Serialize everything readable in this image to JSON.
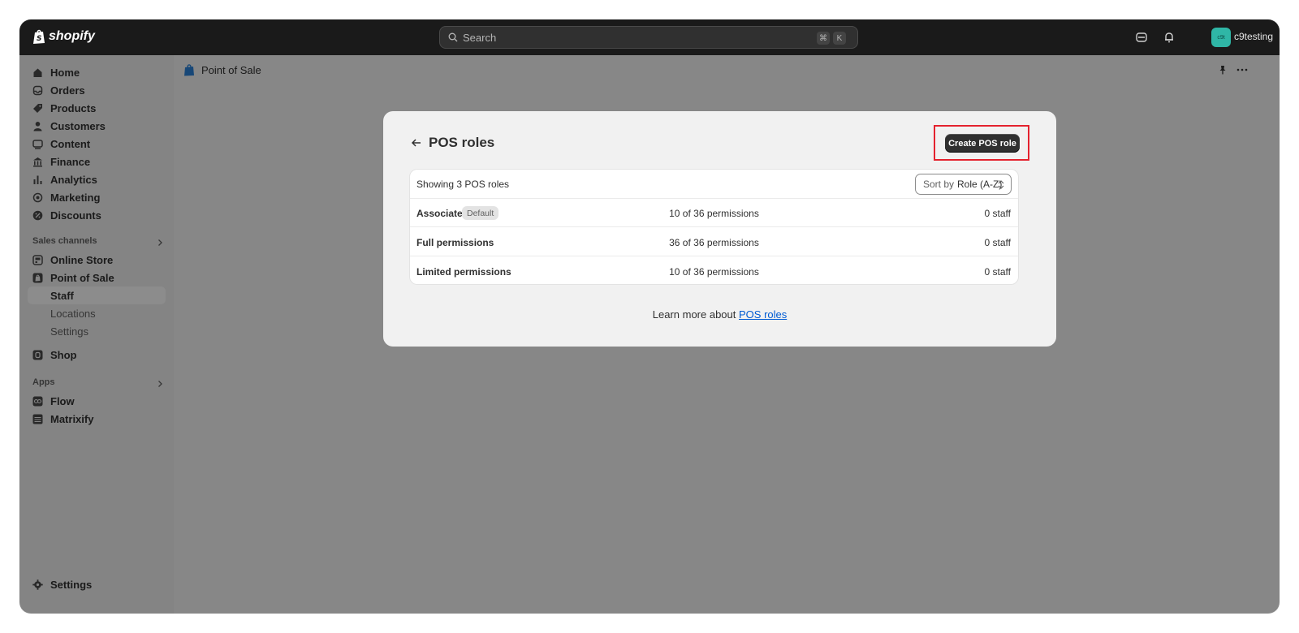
{
  "topbar": {
    "brand": "shopify",
    "search_placeholder": "Search",
    "shortcut_keys": [
      "⌘",
      "K"
    ],
    "avatar_initials": "c9t",
    "store_name": "c9testing"
  },
  "sidebar": {
    "primary": [
      {
        "label": "Home",
        "icon": "home-icon"
      },
      {
        "label": "Orders",
        "icon": "inbox-icon"
      },
      {
        "label": "Products",
        "icon": "tag-icon"
      },
      {
        "label": "Customers",
        "icon": "person-icon"
      },
      {
        "label": "Content",
        "icon": "content-icon"
      },
      {
        "label": "Finance",
        "icon": "bank-icon"
      },
      {
        "label": "Analytics",
        "icon": "bar-chart-icon"
      },
      {
        "label": "Marketing",
        "icon": "target-icon"
      },
      {
        "label": "Discounts",
        "icon": "discount-icon"
      }
    ],
    "sales_channels_label": "Sales channels",
    "channels": [
      {
        "label": "Online Store",
        "icon": "store-icon"
      },
      {
        "label": "Point of Sale",
        "icon": "pos-icon"
      }
    ],
    "pos_sub": [
      "Staff",
      "Locations",
      "Settings"
    ],
    "shop": {
      "label": "Shop",
      "icon": "shop-icon"
    },
    "apps_label": "Apps",
    "apps": [
      {
        "label": "Flow",
        "icon": "flow-icon"
      },
      {
        "label": "Matrixify",
        "icon": "grid-icon"
      }
    ],
    "settings_label": "Settings"
  },
  "main": {
    "breadcrumb": "Point of Sale"
  },
  "modal": {
    "title": "POS roles",
    "create_button": "Create POS role",
    "count_text": "Showing 3 POS roles",
    "sort_prefix": "Sort by",
    "sort_value": "Role (A-Z)",
    "roles": [
      {
        "name": "Associate",
        "badge": "Default",
        "permissions": "10 of 36 permissions",
        "staff": "0 staff"
      },
      {
        "name": "Full permissions",
        "permissions": "36 of 36 permissions",
        "staff": "0 staff"
      },
      {
        "name": "Limited permissions",
        "permissions": "10 of 36 permissions",
        "staff": "0 staff"
      }
    ],
    "learn_prefix": "Learn more about",
    "learn_link": "POS roles"
  },
  "colors": {
    "topbar_bg": "#1a1a1a",
    "primary_button": "#303030",
    "highlight": "#e4222e",
    "link": "#005bd3",
    "avatar": "#2fb6a6"
  }
}
